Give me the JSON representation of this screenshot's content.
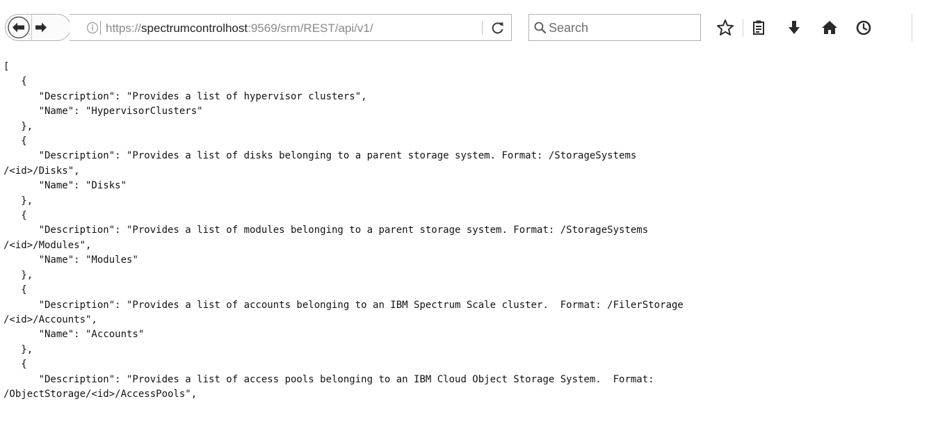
{
  "browser": {
    "url_scheme": "https://",
    "url_host": "spectrumcontrolhost",
    "url_rest": ":9569/srm/REST/api/v1/",
    "search_placeholder": "Search"
  },
  "icons": {
    "back": "back-arrow-icon",
    "forward": "forward-arrow-icon",
    "info": "info-icon",
    "reload": "reload-icon",
    "search": "search-icon",
    "bookmark": "star-icon",
    "reading_list": "clipboard-icon",
    "downloads": "download-icon",
    "home": "home-icon",
    "history": "clock-icon"
  },
  "colors": {
    "text": "#111111",
    "chrome_border": "#b1b1b1",
    "url_gray": "#8a8a8a",
    "icon": "#2a2a2a"
  },
  "json_lines": [
    "[",
    "   {",
    "      \"Description\": \"Provides a list of hypervisor clusters\",",
    "      \"Name\": \"HypervisorClusters\"",
    "   },",
    "   {",
    "      \"Description\": \"Provides a list of disks belonging to a parent storage system. Format: /StorageSystems",
    "/<id>/Disks\",",
    "      \"Name\": \"Disks\"",
    "   },",
    "   {",
    "      \"Description\": \"Provides a list of modules belonging to a parent storage system. Format: /StorageSystems",
    "/<id>/Modules\",",
    "      \"Name\": \"Modules\"",
    "   },",
    "   {",
    "      \"Description\": \"Provides a list of accounts belonging to an IBM Spectrum Scale cluster.  Format: /FilerStorage",
    "/<id>/Accounts\",",
    "      \"Name\": \"Accounts\"",
    "   },",
    "   {",
    "      \"Description\": \"Provides a list of access pools belonging to an IBM Cloud Object Storage System.  Format:",
    "/ObjectStorage/<id>/AccessPools\","
  ]
}
